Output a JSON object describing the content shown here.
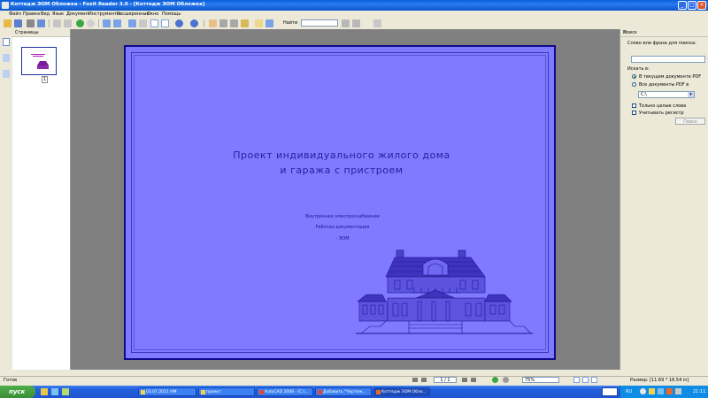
{
  "window": {
    "title": "Коттедж ЭОМ Обложка - Foxit Reader 3.0 - [Коттедж ЭОМ Обложка]",
    "controls": [
      "_",
      "□",
      "×"
    ]
  },
  "menu": [
    "Файл",
    "Правка",
    "Вид",
    "Язык",
    "Документ",
    "Инструменты",
    "Расширенные",
    "Окно",
    "Помощь"
  ],
  "toolbar": {
    "find_label": "Найти",
    "find_value": ""
  },
  "pages_panel": {
    "header": "Страницы",
    "thumb_page": "1"
  },
  "document": {
    "title_line1": "Проект индивидуального жилого дома",
    "title_line2": "и гаража с пристроем",
    "sub1": "Внутреннее электроснабжение",
    "sub2": "Рабочая документация",
    "sub3": "- ЭОМ"
  },
  "search_panel": {
    "header": "Поиск",
    "close": "×",
    "prompt": "Слово или фраза для поиска:",
    "query": "",
    "look_in": "Искать в:",
    "opt_current": "В текущем документе PDF",
    "opt_all": "Все документы PDF в",
    "folder": "C:\\",
    "whole_words": "Только целые слова",
    "case_sensitive": "Учитывать регистр",
    "search_button": "Поиск"
  },
  "statusbar": {
    "left": "Готов",
    "page_value": "1 / 1",
    "zoom_value": "75%",
    "size": "Размер: [11.69 * 16.54 in]"
  },
  "taskbar": {
    "start": "пуск",
    "buttons": [
      "03.07.2011 HM",
      "проект",
      "AutoCAD 2008 - [C:\\...",
      "Добавить \"Чертеж...",
      "Коттедж ЭОМ Обло..."
    ],
    "lang": "RU",
    "clock": "21:11"
  },
  "colors": {
    "page_fill": "#7f7aff",
    "page_ink": "#2a1fa0",
    "workspace": "#808080"
  }
}
